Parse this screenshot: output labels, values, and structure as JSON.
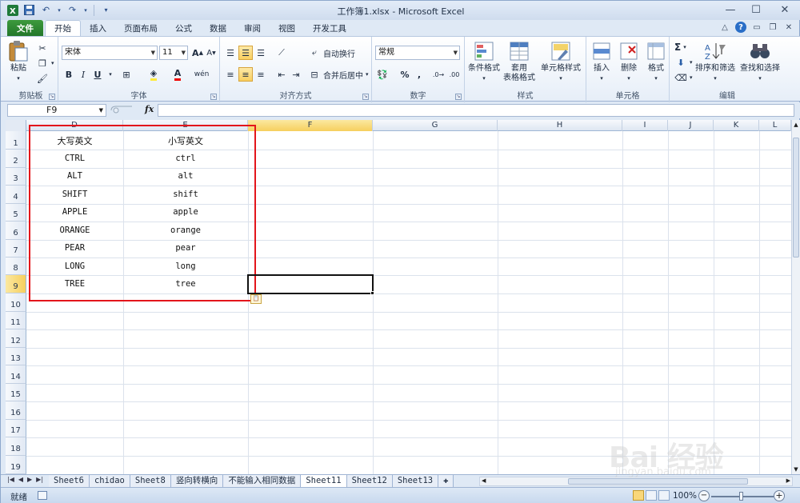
{
  "titlebar": {
    "title": "工作簿1.xlsx - Microsoft Excel",
    "minimize": "—",
    "maximize": "☐",
    "close": "✕"
  },
  "tabs": [
    {
      "label": "文件"
    },
    {
      "label": "开始"
    },
    {
      "label": "插入"
    },
    {
      "label": "页面布局"
    },
    {
      "label": "公式"
    },
    {
      "label": "数据"
    },
    {
      "label": "审阅"
    },
    {
      "label": "视图"
    },
    {
      "label": "开发工具"
    }
  ],
  "ribbon": {
    "clipboard": {
      "paste": "粘贴",
      "label": "剪贴板"
    },
    "font": {
      "name": "宋体",
      "size": "11",
      "bold": "B",
      "italic": "I",
      "underline": "U",
      "label": "字体"
    },
    "alignment": {
      "wrap": "自动换行",
      "merge": "合并后居中",
      "label": "对齐方式"
    },
    "number": {
      "format": "常规",
      "percent": "%",
      "comma": ",",
      "label": "数字"
    },
    "styles": {
      "conditional": "条件格式",
      "table_line1": "套用",
      "table_line2": "表格格式",
      "cell": "单元格样式",
      "label": "样式"
    },
    "cells": {
      "insert": "插入",
      "delete": "删除",
      "format": "格式",
      "label": "单元格"
    },
    "editing": {
      "sort": "排序和筛选",
      "find": "查找和选择",
      "label": "编辑",
      "sum": "Σ"
    }
  },
  "formula_bar": {
    "name_box": "F9",
    "fx": "fx",
    "value": ""
  },
  "columns": [
    {
      "label": "D"
    },
    {
      "label": "E"
    },
    {
      "label": "F"
    },
    {
      "label": "G"
    },
    {
      "label": "H"
    },
    {
      "label": "I"
    },
    {
      "label": "J"
    },
    {
      "label": "K"
    },
    {
      "label": "L"
    }
  ],
  "rows": [
    "1",
    "2",
    "3",
    "4",
    "5",
    "6",
    "7",
    "8",
    "9",
    "10",
    "11",
    "12",
    "13",
    "14",
    "15",
    "16",
    "17",
    "18",
    "19"
  ],
  "table": {
    "header_upper": "大写英文",
    "header_lower": "小写英文",
    "upper": [
      "CTRL",
      "ALT",
      "SHIFT",
      "APPLE",
      "ORANGE",
      "PEAR",
      "LONG",
      "TREE"
    ],
    "lower": [
      "ctrl",
      "alt",
      "shift",
      "apple",
      "orange",
      "pear",
      "long",
      "tree"
    ]
  },
  "sheets": [
    {
      "label": "Sheet6"
    },
    {
      "label": "chidao"
    },
    {
      "label": "Sheet8"
    },
    {
      "label": "竖向转横向"
    },
    {
      "label": "不能输入相同数据"
    },
    {
      "label": "Sheet11"
    },
    {
      "label": "Sheet12"
    },
    {
      "label": "Sheet13"
    }
  ],
  "status": {
    "ready": "就绪",
    "zoom": "100%",
    "zoom_minus": "−",
    "zoom_plus": "+"
  },
  "watermark": {
    "brand": "Bai 经验",
    "url": "jingyan.baidu.com"
  },
  "colors": {
    "accent_red": "#e3151b",
    "file_tab": "#2f8a34",
    "selected_header": "#f6cf5e"
  }
}
